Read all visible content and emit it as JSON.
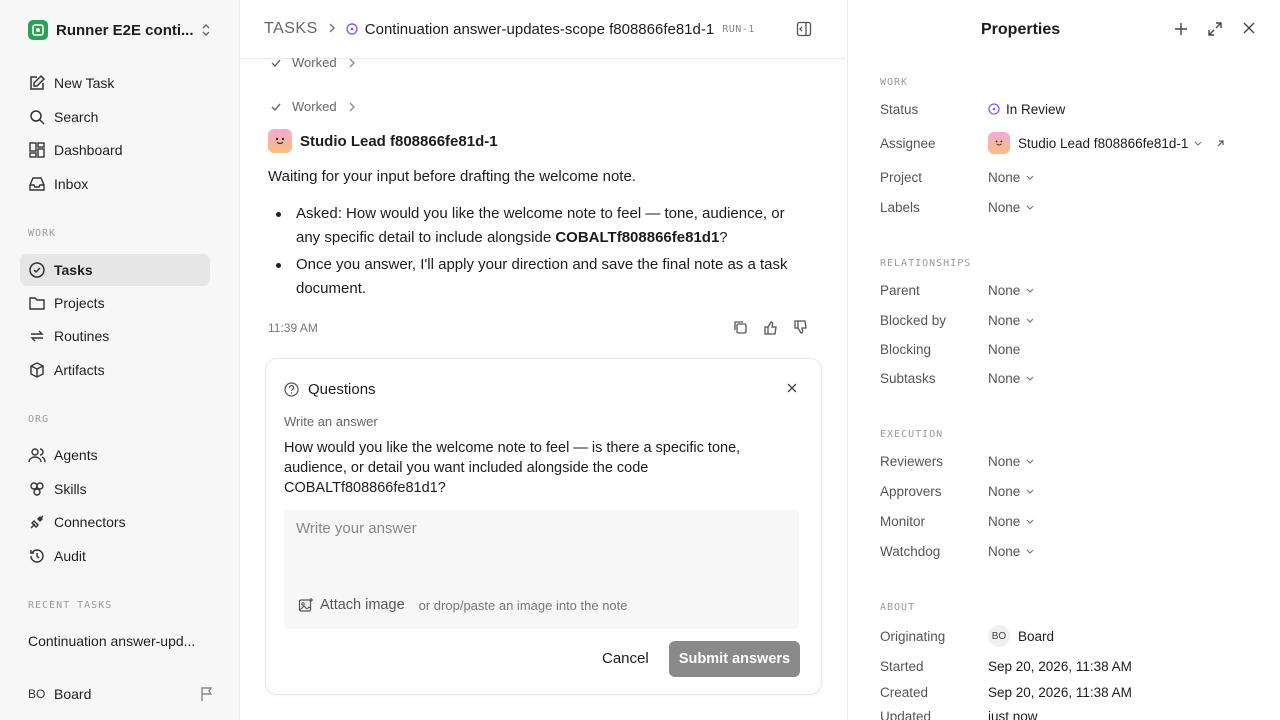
{
  "workspace": {
    "name": "Runner E2E conti..."
  },
  "nav": {
    "new_task": "New Task",
    "search": "Search",
    "dashboard": "Dashboard",
    "inbox": "Inbox",
    "work_section": "WORK",
    "tasks": "Tasks",
    "projects": "Projects",
    "routines": "Routines",
    "artifacts": "Artifacts",
    "org_section": "ORG",
    "agents": "Agents",
    "skills": "Skills",
    "connectors": "Connectors",
    "audit": "Audit",
    "recent_section": "RECENT TASKS",
    "recent_task": "Continuation answer-upd..."
  },
  "user": {
    "initials": "BO",
    "name": "Board"
  },
  "header": {
    "root": "TASKS",
    "title": "Continuation answer-updates-scope f808866fe81d-1",
    "run": "RUN-1"
  },
  "thread": {
    "worked_label": "Worked",
    "author": "Studio Lead f808866fe81d-1",
    "message": "Waiting for your input before drafting the welcome note.",
    "bullet1_prefix": "Asked: How would you like the welcome note to feel — tone, audience, or any specific detail to include alongside ",
    "bullet1_code": "COBALTf808866fe81d1",
    "bullet1_suffix": "?",
    "bullet2": "Once you answer, I'll apply your direction and save the final note as a task document.",
    "time": "11:39 AM"
  },
  "questions": {
    "title": "Questions",
    "label": "Write an answer",
    "question": "How would you like the welcome note to feel — is there a specific tone, audience, or detail you want included alongside the code COBALTf808866fe81d1?",
    "placeholder": "Write your answer",
    "attach": "Attach image",
    "hint": "or drop/paste an image into the note",
    "cancel": "Cancel",
    "submit": "Submit answers"
  },
  "properties": {
    "title": "Properties",
    "work_section": "WORK",
    "status_label": "Status",
    "status_value": "In Review",
    "assignee_label": "Assignee",
    "assignee_value": "Studio Lead f808866fe81d-1",
    "project_label": "Project",
    "labels_label": "Labels",
    "relationships_section": "RELATIONSHIPS",
    "parent_label": "Parent",
    "blocked_by_label": "Blocked by",
    "blocking_label": "Blocking",
    "subtasks_label": "Subtasks",
    "execution_section": "EXECUTION",
    "reviewers_label": "Reviewers",
    "approvers_label": "Approvers",
    "monitor_label": "Monitor",
    "watchdog_label": "Watchdog",
    "none": "None",
    "about_section": "ABOUT",
    "originating_label": "Originating",
    "originating_initials": "BO",
    "originating_value": "Board",
    "started_label": "Started",
    "started_value": "Sep 20, 2026, 11:38 AM",
    "created_label": "Created",
    "created_value": "Sep 20, 2026, 11:38 AM",
    "updated_label": "Updated",
    "updated_value": "just now"
  },
  "colors": {
    "accent": "#7c3aed",
    "status_review": "#8b5cf6",
    "brand": "#2e9e5b"
  }
}
